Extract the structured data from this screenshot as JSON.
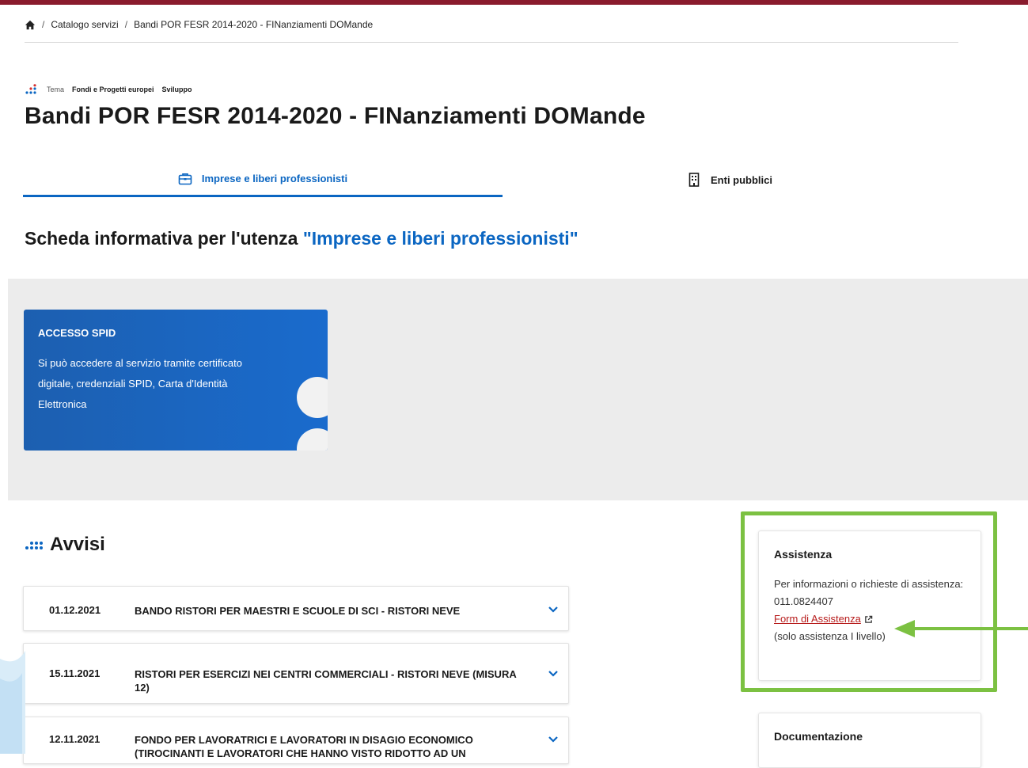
{
  "breadcrumb": {
    "items": [
      "Catalogo servizi",
      "Bandi POR FESR 2014-2020 - FINanziamenti DOMande"
    ]
  },
  "theme": {
    "prefix": "Tema",
    "tags": [
      "Fondi e Progetti europei",
      "Sviluppo"
    ]
  },
  "page_title": "Bandi POR FESR 2014-2020 - FINanziamenti DOMande",
  "tabs": [
    {
      "label": "Imprese e liberi professionisti",
      "icon": "briefcase-icon",
      "active": true
    },
    {
      "label": "Enti pubblici",
      "icon": "building-icon",
      "active": false
    }
  ],
  "section": {
    "title_prefix": "Scheda informativa per l'utenza ",
    "title_highlight": "\"Imprese e liberi professionisti\""
  },
  "spid_card": {
    "title": "ACCESSO SPID",
    "text": "Si può accedere al servizio tramite certificato digitale, credenziali SPID, Carta d'Identità Elettronica"
  },
  "avvisi": {
    "title": "Avvisi",
    "items": [
      {
        "date": "01.12.2021",
        "title": "BANDO RISTORI PER MAESTRI E SCUOLE DI SCI - RISTORI NEVE"
      },
      {
        "date": "15.11.2021",
        "title": "RISTORI PER ESERCIZI NEI CENTRI COMMERCIALI - RISTORI NEVE (MISURA 12)"
      },
      {
        "date": "12.11.2021",
        "title": "FONDO PER LAVORATRICI E LAVORATORI IN DISAGIO ECONOMICO (TIROCINANTI E LAVORATORI CHE HANNO VISTO RIDOTTO AD UN"
      }
    ]
  },
  "assistenza": {
    "title": "Assistenza",
    "text": "Per informazioni o richieste di assistenza: 011.0824407",
    "link": "Form di Assistenza",
    "note": "(solo assistenza I livello)"
  },
  "documentazione": {
    "title": "Documentazione"
  },
  "colors": {
    "topbar": "#8a1b2d",
    "accent_blue": "#0b66c2",
    "highlight_green": "#7cc142",
    "link_red": "#b71c1c"
  }
}
